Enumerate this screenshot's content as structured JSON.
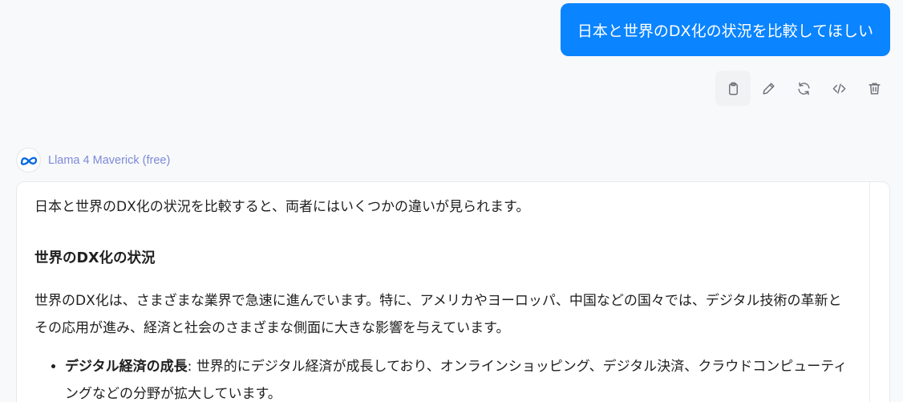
{
  "user_message": {
    "text": "日本と世界のDX化の状況を比較してほしい",
    "bubble_color": "#0a84ff"
  },
  "actions": [
    {
      "name": "copy",
      "icon": "clipboard-icon"
    },
    {
      "name": "edit",
      "icon": "pencil-icon"
    },
    {
      "name": "regenerate",
      "icon": "refresh-icon"
    },
    {
      "name": "view-source",
      "icon": "code-icon"
    },
    {
      "name": "delete",
      "icon": "trash-icon"
    }
  ],
  "assistant": {
    "model_name": "Llama 4 Maverick (free)",
    "model_icon": "meta-logo-icon",
    "model_name_color": "#7d8ad6"
  },
  "answer": {
    "intro": "日本と世界のDX化の状況を比較すると、両者にはいくつかの違いが見られます。",
    "section_heading": "世界のDX化の状況",
    "section_body": "世界のDX化は、さまざまな業界で急速に進んでいます。特に、アメリカやヨーロッパ、中国などの国々では、デジタル技術の革新とその応用が進み、経済と社会のさまざまな側面に大きな影響を与えています。",
    "bullets": [
      {
        "title": "デジタル経済の成長",
        "text": ": 世界的にデジタル経済が成長しており、オンラインショッピング、デジタル決済、クラウドコンピューティングなどの分野が拡大しています。"
      }
    ]
  }
}
